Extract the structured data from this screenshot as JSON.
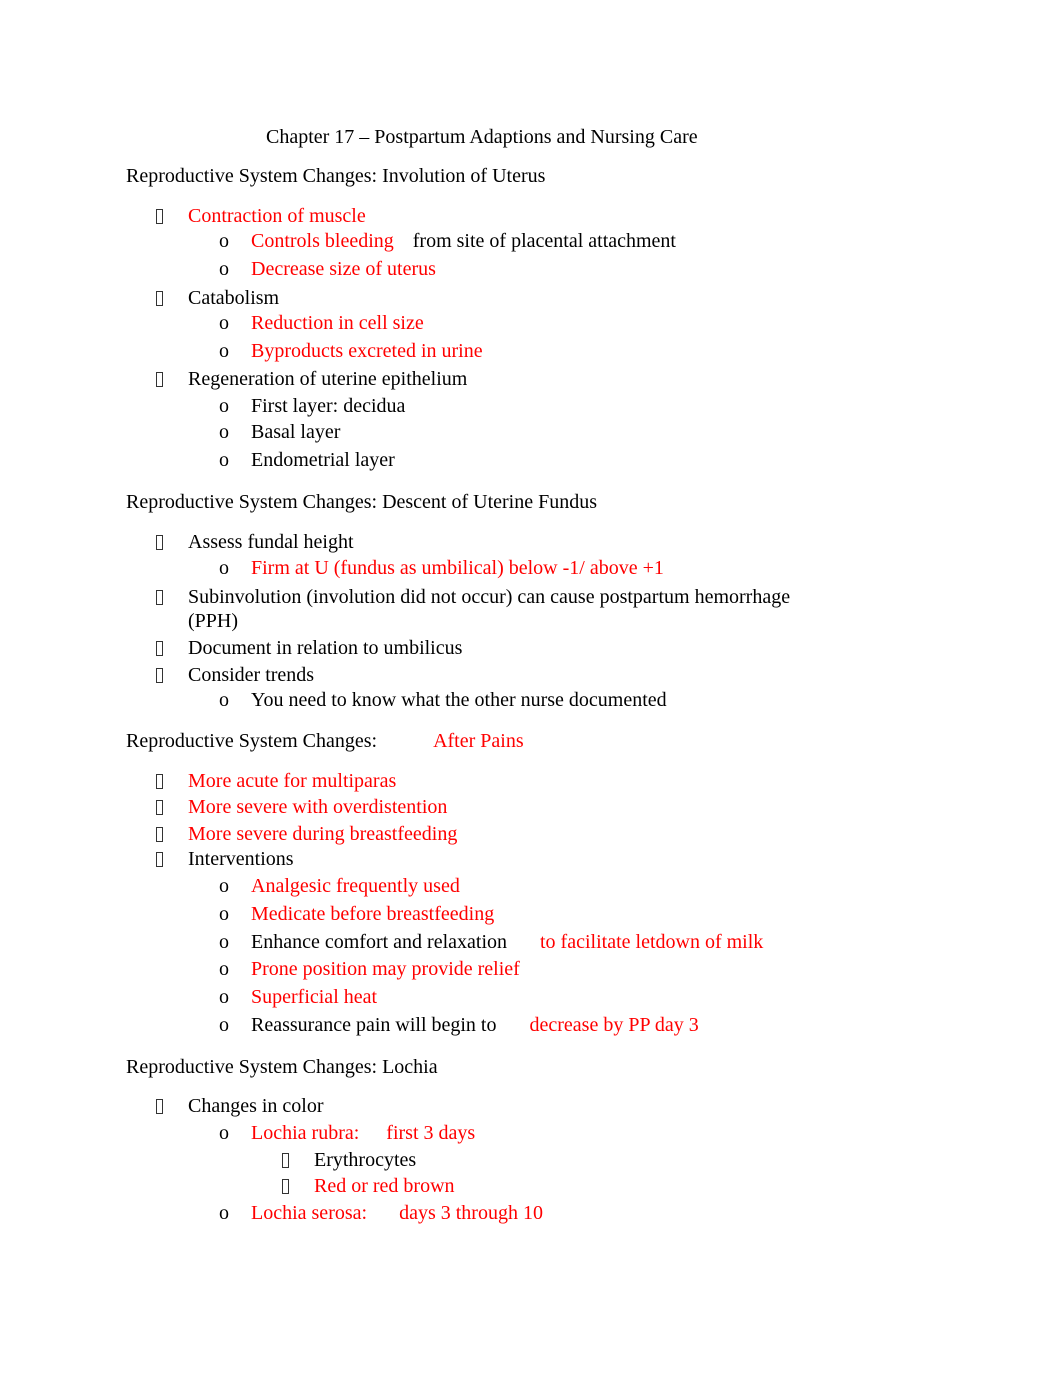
{
  "document": {
    "title": "Chapter 17 – Postpartum Adaptions and Nursing Care",
    "bullet_icon": "square-bullet",
    "sub_bullet": "o",
    "colors": {
      "highlight": "#ff0000",
      "text": "#000000"
    },
    "sections": [
      {
        "heading": "Reproductive System Changes: Involution of Uterus",
        "items": [
          {
            "text": "Contraction of muscle",
            "color": "red",
            "sub": [
              {
                "text": "Controls bleeding",
                "text2": "from site of placental attachment"
              },
              {
                "text": "Decrease size of uterus"
              }
            ]
          },
          {
            "text": "Catabolism",
            "sub": [
              {
                "text": "Reduction in cell size"
              },
              {
                "text": "Byproducts excreted in urine"
              }
            ]
          },
          {
            "text": "Regeneration of uterine epithelium",
            "sub": [
              {
                "text": "First layer: decidua"
              },
              {
                "text": "Basal layer"
              },
              {
                "text": "Endometrial layer"
              }
            ]
          }
        ]
      },
      {
        "heading": "Reproductive System Changes: Descent of Uterine Fundus",
        "items": [
          {
            "text": "Assess fundal height",
            "sub": [
              {
                "text": "Firm at U (fundus as umbilical) below -1/ above +1"
              }
            ]
          },
          {
            "text": "Subinvolution (involution did not occur) can cause postpartum hemorrhage",
            "text_cont": "(PPH)"
          },
          {
            "text": "Document in relation to umbilicus"
          },
          {
            "text": "Consider trends",
            "sub": [
              {
                "text": "You need to know what the other nurse documented"
              }
            ]
          }
        ]
      },
      {
        "heading": "Reproductive System Changes:",
        "heading_highlight": "After Pains",
        "items": [
          {
            "text": "More acute for multiparas"
          },
          {
            "text": "More severe with overdistention"
          },
          {
            "text": "More severe during breastfeeding"
          },
          {
            "text": "Interventions",
            "sub": [
              {
                "text": "Analgesic frequently used"
              },
              {
                "text": "Medicate before breastfeeding"
              },
              {
                "text": "Enhance comfort and relaxation",
                "text2": "to facilitate letdown of milk"
              },
              {
                "text": "Prone position may provide relief"
              },
              {
                "text": "Superficial heat"
              },
              {
                "text": "Reassurance pain will begin to",
                "text2": "decrease by PP day 3"
              }
            ]
          }
        ]
      },
      {
        "heading": "Reproductive System Changes: Lochia",
        "items": [
          {
            "text": "Changes in color",
            "sub": [
              {
                "text": "Lochia rubra:",
                "text2": "first 3 days",
                "sub": [
                  {
                    "text": "Erythrocytes"
                  },
                  {
                    "text": "Red or red brown"
                  }
                ]
              },
              {
                "text": "Lochia serosa:",
                "text2": "days 3 through 10"
              }
            ]
          }
        ]
      }
    ]
  }
}
